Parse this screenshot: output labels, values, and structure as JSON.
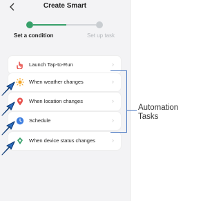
{
  "header": {
    "back_icon": "chevron-left-icon",
    "title": "Create Smart"
  },
  "steps": {
    "progress": 0.5,
    "step1": "Set a condition",
    "step2": "Set up task"
  },
  "options": [
    {
      "label": "Launch Tap-to-Run",
      "icon": "hand-tap-icon",
      "color": "#e8544f"
    },
    {
      "label": "When weather changes",
      "icon": "sun-icon",
      "color": "#f5a524"
    },
    {
      "label": "When location changes",
      "icon": "location-pin-icon",
      "color": "#e8544f"
    },
    {
      "label": "Schedule",
      "icon": "clock-icon",
      "color": "#3f7fe0"
    },
    {
      "label": "When device status changes",
      "icon": "device-icon",
      "color": "#37a06a"
    }
  ],
  "annotation": {
    "line1": "Automation",
    "line2": "Tasks",
    "color": "#4a78c2"
  }
}
